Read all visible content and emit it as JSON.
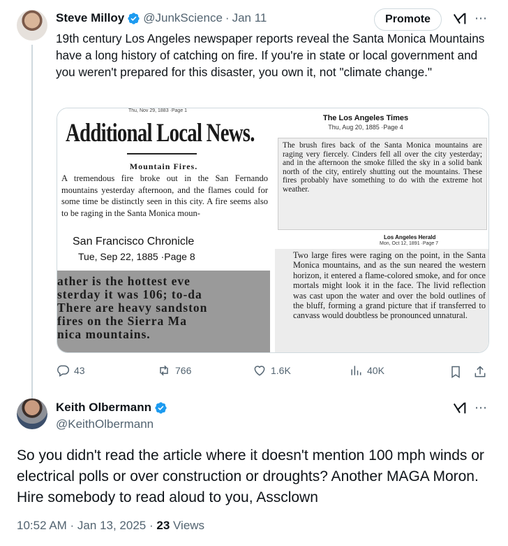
{
  "tweet1": {
    "name": "Steve Milloy",
    "handle": "@JunkScience",
    "separator": "·",
    "date": "Jan 11",
    "promote_label": "Promote",
    "text": "19th century Los Angeles newspaper reports reveal the Santa Monica Mountains have a long history of catching on fire. If you're in state or local government and you weren't prepared for this disaster, you own it, not \"climate change.\"",
    "media": {
      "clip1": {
        "top_stamp": "Thu, Nov 29, 1883 ·Page 1",
        "headline": "Additional Local News.",
        "subhead": "Mountain Fires.",
        "text": "A tremendous fire broke out in the San Fernando mountains yesterday afternoon, and the flames could for some time be distinctly seen in this city. A fire seems also to be raging in the Santa Monica moun-"
      },
      "clip2": {
        "publication": "The Los Angeles Times",
        "date": "Thu, Aug 20, 1885 ·Page 4",
        "text": "The brush fires back of the Santa Monica mountains are raging very fiercely. Cinders fell all over the city yesterday; and in the afternoon the smoke filled the sky in a solid bank north of the city, entirely shutting out the mountains. These fires probably have something to do with the extreme hot weather."
      },
      "clip3": {
        "publication": "San Francisco Chronicle",
        "date": "Tue, Sep 22, 1885 ·Page 8",
        "lines": [
          "ather is the hottest eve",
          "sterday it was 106; to-da",
          "There are heavy sandston",
          " fires on the Sierra Ma",
          "nica mountains."
        ]
      },
      "clip4": {
        "publication": "Los Angeles Herald",
        "date": "Mon, Oct 12, 1891 ·Page 7",
        "text": "Two large fires were raging on the point, in the Santa Monica mountains, and as the sun neared the western horizon, it entered a flame-colored smoke, and for once mortals might look it in the face. The livid reflection was cast upon the water and over the bold outlines of the bluff, forming a grand picture that if transferred to canvass would doubtless be pronounced unnatural."
      }
    },
    "actions": {
      "replies": "43",
      "reposts": "766",
      "likes": "1.6K",
      "views": "40K"
    }
  },
  "tweet2": {
    "name": "Keith Olbermann",
    "handle": "@KeithOlbermann",
    "text": "So you didn't read the article where it doesn't mention 100 mph winds or electrical polls or over construction or droughts? Another MAGA Moron. Hire somebody to read aloud to you, Assclown",
    "timestamp": "10:52 AM · Jan 13, 2025 · ",
    "views_count": "23",
    "views_label": " Views"
  },
  "colors": {
    "text_primary": "#0f1419",
    "text_secondary": "#536471",
    "verified_blue": "#1d9bf0",
    "border": "#cfd9de"
  },
  "icons": [
    "verified-badge-icon",
    "grok-icon",
    "more-icon",
    "reply-icon",
    "repost-icon",
    "like-icon",
    "views-icon",
    "bookmark-icon",
    "share-icon"
  ]
}
